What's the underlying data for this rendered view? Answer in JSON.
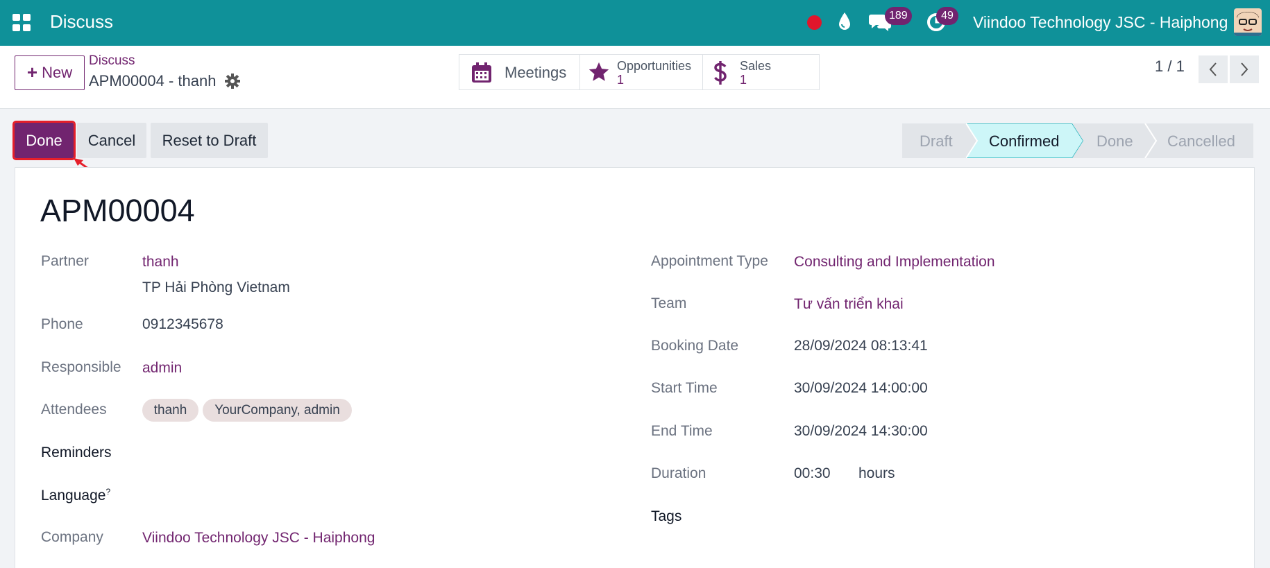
{
  "navbar": {
    "app_name": "Discuss",
    "messages_count": "189",
    "activities_count": "49",
    "company": "Viindoo Technology JSC - Haiphong",
    "bg_color": "#0f9199"
  },
  "control_panel": {
    "new_label": "New",
    "breadcrumb_parent": "Discuss",
    "breadcrumb_current": "APM00004 - thanh",
    "smart_buttons": [
      {
        "label": "Meetings",
        "value": "",
        "icon": "calendar-icon"
      },
      {
        "label": "Opportunities",
        "value": "1",
        "icon": "star-icon"
      },
      {
        "label": "Sales",
        "value": "1",
        "icon": "dollar-icon"
      }
    ],
    "pager": "1 / 1"
  },
  "status_bar": {
    "buttons": {
      "done": "Done",
      "cancel": "Cancel",
      "reset": "Reset to Draft"
    },
    "stages": [
      "Draft",
      "Confirmed",
      "Done",
      "Cancelled"
    ],
    "active_stage": "Confirmed"
  },
  "form": {
    "title": "APM00004",
    "left": {
      "partner_label": "Partner",
      "partner_value": "thanh",
      "partner_address": "TP Hải Phòng Vietnam",
      "phone_label": "Phone",
      "phone_value": "0912345678",
      "responsible_label": "Responsible",
      "responsible_value": "admin",
      "attendees_label": "Attendees",
      "attendees": [
        "thanh",
        "YourCompany, admin"
      ],
      "reminders_label": "Reminders",
      "language_label": "Language",
      "language_help": "?",
      "company_label": "Company",
      "company_value": "Viindoo Technology JSC - Haiphong"
    },
    "right": {
      "appointment_type_label": "Appointment Type",
      "appointment_type_value": "Consulting and Implementation",
      "team_label": "Team",
      "team_value": "Tư vấn triển khai",
      "booking_date_label": "Booking Date",
      "booking_date_value": "28/09/2024 08:13:41",
      "start_time_label": "Start Time",
      "start_time_value": "30/09/2024 14:00:00",
      "end_time_label": "End Time",
      "end_time_value": "30/09/2024 14:30:00",
      "duration_label": "Duration",
      "duration_value": "00:30",
      "duration_unit": "hours",
      "tags_label": "Tags"
    }
  }
}
